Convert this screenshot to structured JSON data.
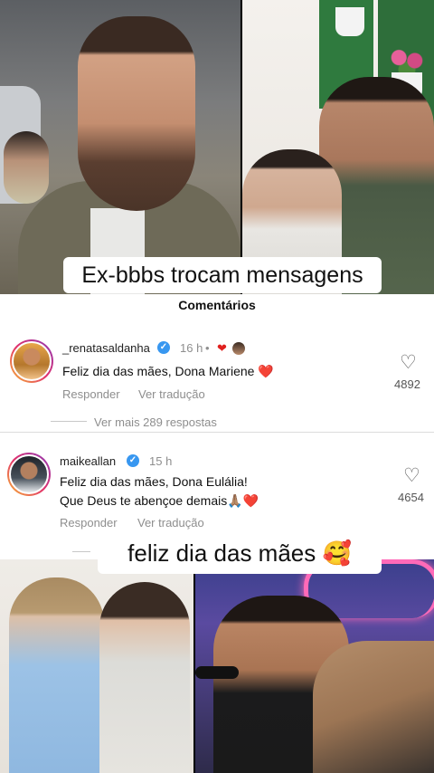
{
  "captions": {
    "top": "Ex-bbbs trocam mensagens",
    "bottom": "feliz dia das mães 🥰"
  },
  "comments_panel": {
    "title": "Comentários",
    "comments": [
      {
        "username": "_renatasaldanha",
        "verified": true,
        "time": "16 h",
        "separator": "•",
        "liked_by_author": "❤",
        "text_lines": [
          "Feliz dia das mães, Dona Mariene ❤️"
        ],
        "reply_label": "Responder",
        "translate_label": "Ver tradução",
        "likes": "4892",
        "more_replies": "Ver mais 289 respostas"
      },
      {
        "username": "maikeallan",
        "verified": true,
        "time": "15 h",
        "text_lines": [
          "Feliz dia das mães, Dona Eulália!",
          "Que Deus te abençoe demais🙏🏽❤️"
        ],
        "reply_label": "Responder",
        "translate_label": "Ver tradução",
        "likes": "4654"
      }
    ]
  },
  "icons": {
    "heart_outline": "♡",
    "verified_check": "✓"
  },
  "colors": {
    "verified_blue": "#3897f0",
    "heart_red": "#e0201e",
    "muted_text": "#8e8e8e"
  }
}
